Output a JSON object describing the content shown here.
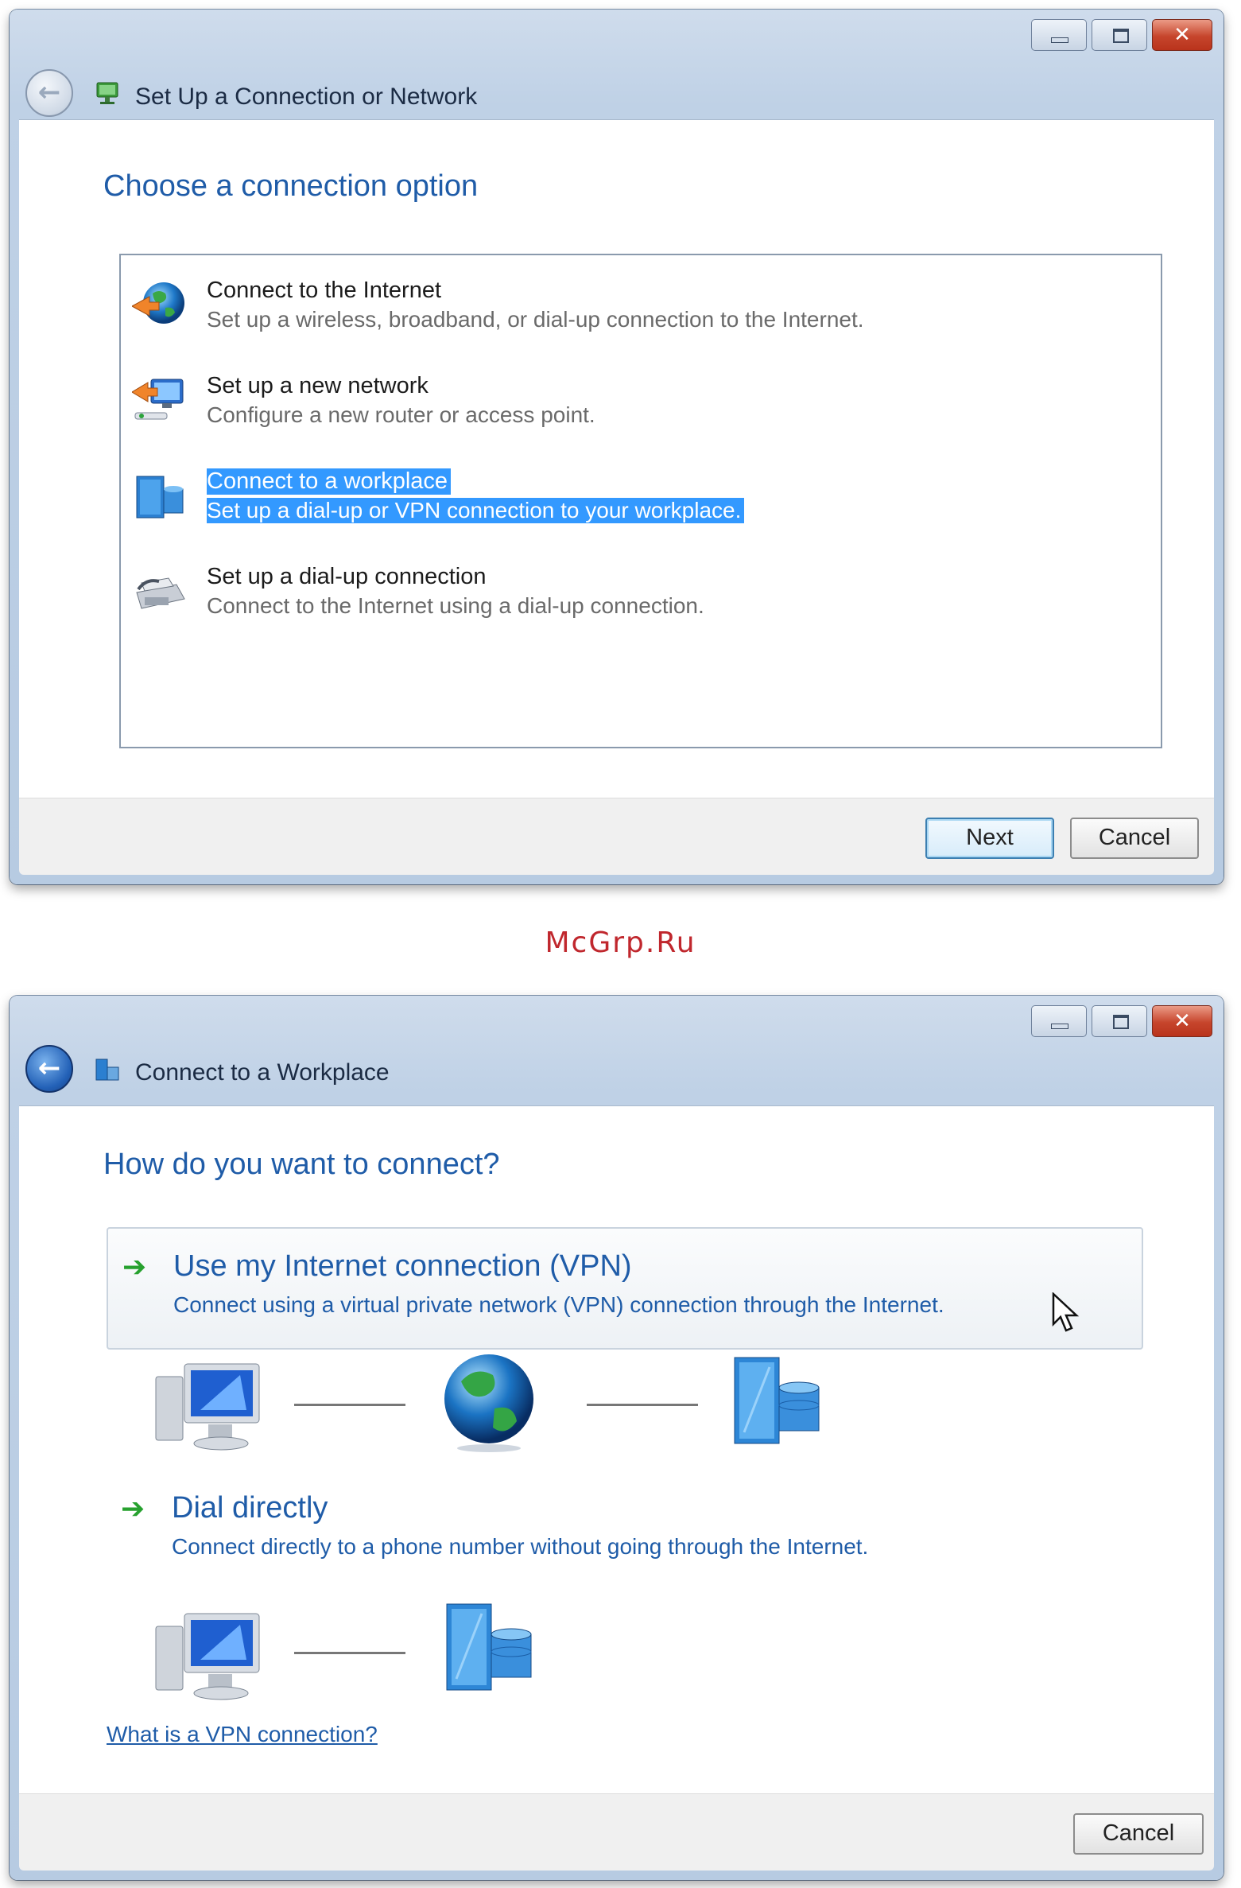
{
  "window1": {
    "title": "Set Up a Connection or Network",
    "heading": "Choose a connection option",
    "options": [
      {
        "title": "Connect to the Internet",
        "subtitle": "Set up a wireless, broadband, or dial-up connection to the Internet.",
        "icon": "globe-icon",
        "selected": false
      },
      {
        "title": "Set up a new network",
        "subtitle": "Configure a new router or access point.",
        "icon": "network-icon",
        "selected": false
      },
      {
        "title": "Connect to a workplace",
        "subtitle": "Set up a dial-up or VPN connection to your workplace.",
        "icon": "workplace-icon",
        "selected": true
      },
      {
        "title": "Set up a dial-up connection",
        "subtitle": "Connect to the Internet using a dial-up connection.",
        "icon": "fax-icon",
        "selected": false
      }
    ],
    "next_label": "Next",
    "cancel_label": "Cancel"
  },
  "watermark": "McGrp.Ru",
  "window2": {
    "title": "Connect to a Workplace",
    "heading": "How do you want to connect?",
    "vpn_title": "Use my Internet connection (VPN)",
    "vpn_subtitle": "Connect using a virtual private network (VPN) connection through the Internet.",
    "dial_title": "Dial directly",
    "dial_subtitle": "Connect directly to a phone number without going through the Internet.",
    "help_link": "What is a VPN connection?",
    "cancel_label": "Cancel"
  },
  "colors": {
    "accent_text": "#1f5ca8",
    "selection": "#3399ff",
    "watermark": "#c0272d",
    "arrow_green": "#27a12f"
  }
}
